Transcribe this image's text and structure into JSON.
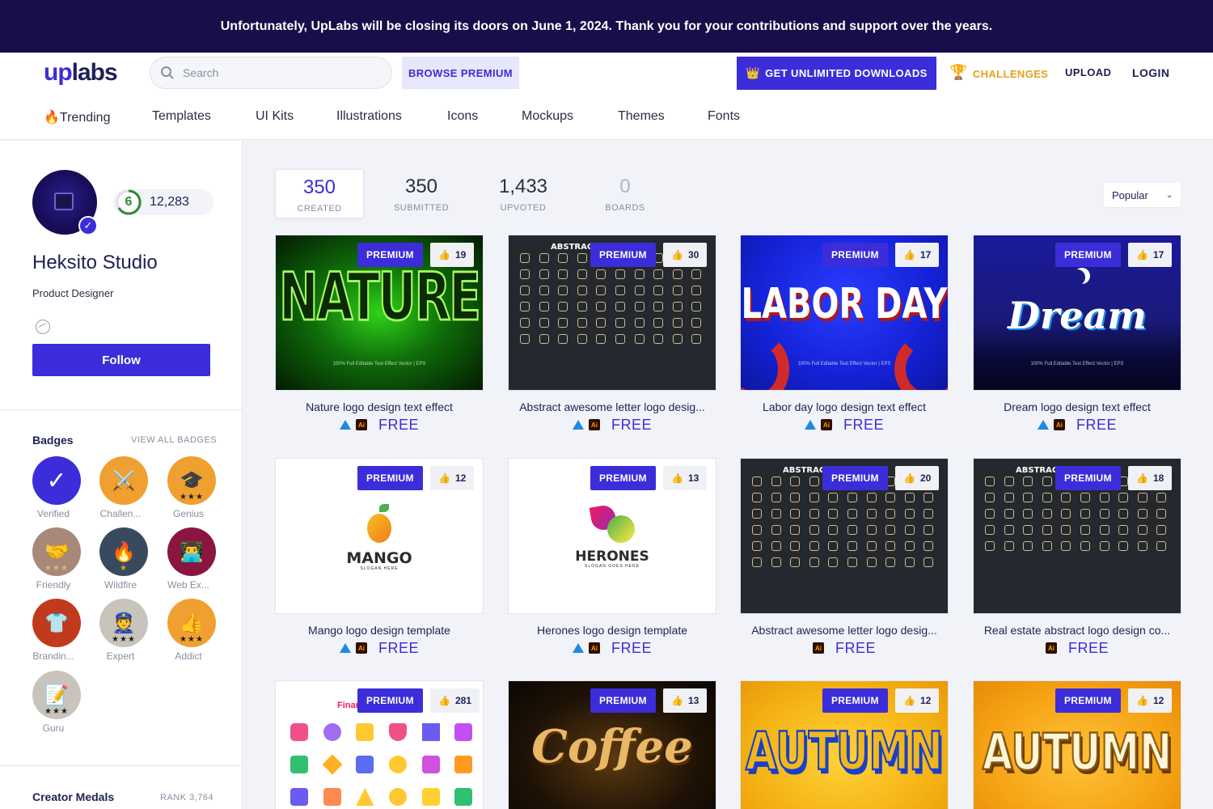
{
  "banner": {
    "text": "Unfortunately, UpLabs will be closing its doors on June 1, 2024. Thank you for your contributions and support over the years."
  },
  "header": {
    "logo_up": "up",
    "logo_labs": "labs",
    "search_placeholder": "Search",
    "browse_premium": "BROWSE PREMIUM",
    "unlimited": "GET UNLIMITED DOWNLOADS",
    "challenges": "CHALLENGES",
    "upload": "UPLOAD",
    "login": "LOGIN"
  },
  "categories": [
    "🔥Trending",
    "Templates",
    "UI Kits",
    "Illustrations",
    "Icons",
    "Mockups",
    "Themes",
    "Fonts"
  ],
  "profile": {
    "level": "6",
    "points": "12,283",
    "name": "Heksito Studio",
    "role": "Product Designer",
    "follow": "Follow"
  },
  "badges": {
    "title": "Badges",
    "view_all": "VIEW ALL BADGES",
    "items": [
      {
        "label": "Verified",
        "icon": "check-icon",
        "color": "#3b2dd9"
      },
      {
        "label": "Challen...",
        "icon": "swords-icon",
        "color": "#f0a030"
      },
      {
        "label": "Genius",
        "icon": "grad-cap-icon",
        "color": "#f0a030"
      },
      {
        "label": "Friendly",
        "icon": "handshake-icon",
        "color": "#a88878"
      },
      {
        "label": "Wildfire",
        "icon": "flame-icon",
        "color": "#3a4a5e"
      },
      {
        "label": "Web Ex...",
        "icon": "laptop-person-icon",
        "color": "#8a1640"
      },
      {
        "label": "Brandin...",
        "icon": "shirt-icon",
        "color": "#c23a1c"
      },
      {
        "label": "Expert",
        "icon": "officer-icon",
        "color": "#c8c4bc"
      },
      {
        "label": "Addict",
        "icon": "thumbs-up-icon",
        "color": "#f0a030"
      },
      {
        "label": "Guru",
        "icon": "notepad-icon",
        "color": "#c8c4bc"
      }
    ]
  },
  "medals": {
    "title": "Creator Medals",
    "rank": "RANK 3,764"
  },
  "stats": [
    {
      "num": "350",
      "label": "CREATED"
    },
    {
      "num": "350",
      "label": "SUBMITTED"
    },
    {
      "num": "1,433",
      "label": "UPVOTED"
    },
    {
      "num": "0",
      "label": "BOARDS"
    }
  ],
  "sort": {
    "value": "Popular"
  },
  "premium_label": "PREMIUM",
  "free_label": "FREE",
  "cards": [
    {
      "title": "Nature logo design text effect",
      "likes": "19",
      "art": "NATURE",
      "sub": "100% Full Editable Text Effect Vector | EPS"
    },
    {
      "title": "Abstract awesome letter logo desig...",
      "likes": "30",
      "art": "ABSTRACT"
    },
    {
      "title": "Labor day logo design text effect",
      "likes": "17",
      "art": "LABOR DAY",
      "sub": "100% Full Editable Text Effect Vector | EPS"
    },
    {
      "title": "Dream logo design text effect",
      "likes": "17",
      "art": "Dream",
      "sub": "100% Full Editable Text Effect Vector | EPS"
    },
    {
      "title": "Mango logo design template",
      "likes": "12",
      "art": "MANGO",
      "sub": "SLOGAN HERE"
    },
    {
      "title": "Herones logo design template",
      "likes": "13",
      "art": "HERONES",
      "sub": "SLOGAN GOES HERE"
    },
    {
      "title": "Abstract awesome letter logo desig...",
      "likes": "20",
      "art": "ABSTRACT"
    },
    {
      "title": "Real estate abstract logo design co...",
      "likes": "18",
      "art": "ABSTRACT"
    },
    {
      "title": "",
      "likes": "281",
      "art": "Finar"
    },
    {
      "title": "",
      "likes": "13",
      "art": "Coffee"
    },
    {
      "title": "",
      "likes": "12",
      "art": "AUTUMN"
    },
    {
      "title": "",
      "likes": "12",
      "art": "AUTUMN"
    }
  ]
}
